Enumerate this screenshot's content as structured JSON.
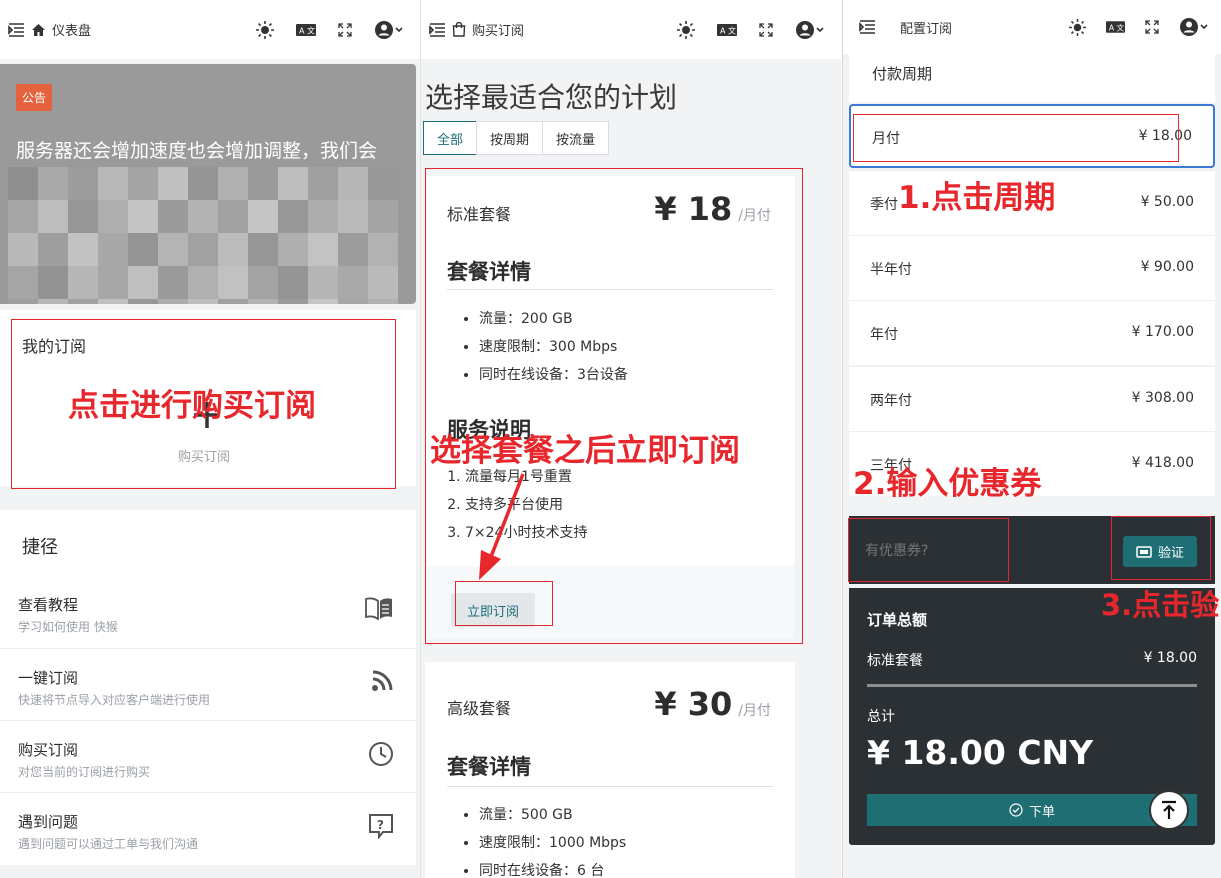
{
  "panel1": {
    "topbar_title": "仪表盘",
    "notice_badge": "公告",
    "notice_title": "服务器还会增加速度也会增加调整，我们会",
    "my_sub_title": "我的订阅",
    "buy_sub_label": "购买订阅",
    "annotation": "点击进行购买订阅",
    "shortcuts_title": "捷径",
    "shortcuts": [
      {
        "title": "查看教程",
        "sub": "学习如何使用 快猴"
      },
      {
        "title": "一键订阅",
        "sub": "快速将节点导入对应客户端进行使用"
      },
      {
        "title": "购买订阅",
        "sub": "对您当前的订阅进行购买"
      },
      {
        "title": "遇到问题",
        "sub": "遇到问题可以通过工单与我们沟通"
      }
    ]
  },
  "panel2": {
    "topbar_title": "购买订阅",
    "heading": "选择最适合您的计划",
    "tabs": [
      "全部",
      "按周期",
      "按流量"
    ],
    "annotation": "选择套餐之后立即订阅",
    "plans": [
      {
        "name": "标准套餐",
        "price": "¥ 18",
        "unit": "/月付",
        "details_title": "套餐详情",
        "details": [
          "流量：200 GB",
          "速度限制：300 Mbps",
          "同时在线设备：3台设备"
        ],
        "service_title": "服务说明",
        "service": [
          "流量每月1号重置",
          "支持多平台使用",
          "7×24小时技术支持"
        ],
        "button": "立即订阅"
      },
      {
        "name": "高级套餐",
        "price": "¥ 30",
        "unit": "/月付",
        "details_title": "套餐详情",
        "details": [
          "流量：500 GB",
          "速度限制：1000 Mbps",
          "同时在线设备：6 台"
        ]
      }
    ]
  },
  "panel3": {
    "topbar_title": "配置订阅",
    "cycle_title": "付款周期",
    "cycles": [
      {
        "name": "月付",
        "price": "¥ 18.00"
      },
      {
        "name": "季付",
        "price": "¥ 50.00"
      },
      {
        "name": "半年付",
        "price": "¥ 90.00"
      },
      {
        "name": "年付",
        "price": "¥ 170.00"
      },
      {
        "name": "两年付",
        "price": "¥ 308.00"
      },
      {
        "name": "三年付",
        "price": "¥ 418.00"
      }
    ],
    "coupon_placeholder": "有优惠券?",
    "verify_label": "验证",
    "total_title": "订单总额",
    "line_name": "标准套餐",
    "line_price": "¥ 18.00",
    "total_label": "总计",
    "total_value": "¥ 18.00 CNY",
    "order_label": "下单",
    "annotations": [
      "1.点击周期",
      "2.输入优惠券",
      "3.点击验"
    ]
  },
  "colors": {
    "accent": "#1a6e78",
    "annotation": "#e8272d",
    "dark_card": "#2b3034",
    "badge": "#e5623f"
  }
}
